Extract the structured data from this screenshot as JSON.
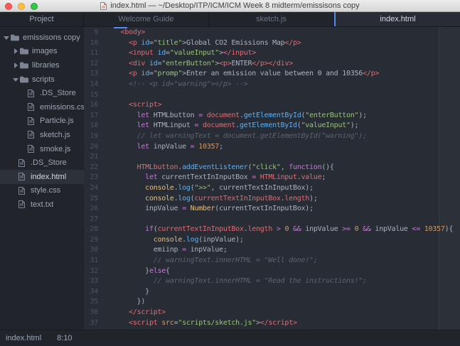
{
  "window": {
    "title": "index.html — ~/Desktop/ITP/ICM/ICM Week 8 midterm/emissisons copy"
  },
  "tabs": [
    {
      "label": "Welcome Guide",
      "active": false
    },
    {
      "label": "sketch.js",
      "active": false
    },
    {
      "label": "index.html",
      "active": true
    }
  ],
  "sidebar": {
    "header": "Project",
    "tree": [
      {
        "label": "emissisons copy",
        "kind": "folder",
        "expanded": true,
        "depth": 0,
        "selected": false
      },
      {
        "label": "images",
        "kind": "folder",
        "expanded": false,
        "depth": 1,
        "selected": false
      },
      {
        "label": "libraries",
        "kind": "folder",
        "expanded": false,
        "depth": 1,
        "selected": false
      },
      {
        "label": "scripts",
        "kind": "folder",
        "expanded": true,
        "depth": 1,
        "selected": false
      },
      {
        "label": ".DS_Store",
        "kind": "file",
        "depth": 2,
        "selected": false
      },
      {
        "label": "emissions.csv",
        "kind": "file",
        "depth": 2,
        "selected": false
      },
      {
        "label": "Particle.js",
        "kind": "file",
        "depth": 2,
        "selected": false
      },
      {
        "label": "sketch.js",
        "kind": "file",
        "depth": 2,
        "selected": false
      },
      {
        "label": "smoke.js",
        "kind": "file",
        "depth": 2,
        "selected": false
      },
      {
        "label": ".DS_Store",
        "kind": "file",
        "depth": 1,
        "selected": false
      },
      {
        "label": "index.html",
        "kind": "file",
        "depth": 1,
        "selected": true
      },
      {
        "label": "style.css",
        "kind": "file",
        "depth": 1,
        "selected": false
      },
      {
        "label": "text.txt",
        "kind": "file",
        "depth": 1,
        "selected": false
      }
    ]
  },
  "editor": {
    "lines": [
      {
        "num": 9,
        "tokens": [
          [
            "p",
            "  "
          ],
          [
            "t",
            "<body>"
          ]
        ]
      },
      {
        "num": 10,
        "tokens": [
          [
            "p",
            "    "
          ],
          [
            "t",
            "<p"
          ],
          [
            "p",
            " "
          ],
          [
            "a",
            "id"
          ],
          [
            "p",
            "="
          ],
          [
            "s",
            "\"title\""
          ],
          [
            "p",
            ">"
          ],
          [
            "p",
            "Global CO2 Emissions Map"
          ],
          [
            "t",
            "</p>"
          ]
        ]
      },
      {
        "num": 11,
        "tokens": [
          [
            "p",
            "    "
          ],
          [
            "t",
            "<input"
          ],
          [
            "p",
            " "
          ],
          [
            "a",
            "id"
          ],
          [
            "p",
            "="
          ],
          [
            "s",
            "\"valueInput\""
          ],
          [
            "p",
            ">"
          ],
          [
            "t",
            "</input>"
          ]
        ]
      },
      {
        "num": 12,
        "tokens": [
          [
            "p",
            "    "
          ],
          [
            "t",
            "<div"
          ],
          [
            "p",
            " "
          ],
          [
            "a",
            "id"
          ],
          [
            "p",
            "="
          ],
          [
            "s",
            "\"enterButton\""
          ],
          [
            "p",
            ">"
          ],
          [
            "t",
            "<p>"
          ],
          [
            "p",
            "ENTER"
          ],
          [
            "t",
            "</p></div>"
          ]
        ]
      },
      {
        "num": 13,
        "tokens": [
          [
            "p",
            "    "
          ],
          [
            "t",
            "<p"
          ],
          [
            "p",
            " "
          ],
          [
            "a",
            "id"
          ],
          [
            "p",
            "="
          ],
          [
            "s",
            "\"promp\""
          ],
          [
            "p",
            ">"
          ],
          [
            "p",
            "Enter an emission value between 0 and 10356"
          ],
          [
            "t",
            "</p>"
          ]
        ]
      },
      {
        "num": 14,
        "tokens": [
          [
            "p",
            "    "
          ],
          [
            "c",
            "<!-- <p id=\"warning\"></p> -->"
          ]
        ]
      },
      {
        "num": 15,
        "tokens": []
      },
      {
        "num": 16,
        "tokens": [
          [
            "p",
            "    "
          ],
          [
            "t",
            "<script>"
          ]
        ]
      },
      {
        "num": 17,
        "tokens": [
          [
            "p",
            "      "
          ],
          [
            "k",
            "let"
          ],
          [
            "p",
            " HTMLbutton "
          ],
          [
            "k",
            "="
          ],
          [
            "p",
            " "
          ],
          [
            "o",
            "document"
          ],
          [
            "p",
            "."
          ],
          [
            "f",
            "getElementById"
          ],
          [
            "p",
            "("
          ],
          [
            "s",
            "\"enterButton\""
          ],
          [
            "p",
            ");"
          ]
        ]
      },
      {
        "num": 18,
        "tokens": [
          [
            "p",
            "      "
          ],
          [
            "k",
            "let"
          ],
          [
            "p",
            " HTMLinput "
          ],
          [
            "k",
            "="
          ],
          [
            "p",
            " "
          ],
          [
            "o",
            "document"
          ],
          [
            "p",
            "."
          ],
          [
            "f",
            "getElementById"
          ],
          [
            "p",
            "("
          ],
          [
            "s",
            "\"valueInput\""
          ],
          [
            "p",
            ");"
          ]
        ]
      },
      {
        "num": 19,
        "tokens": [
          [
            "p",
            "      "
          ],
          [
            "c",
            "// let warningText = document.getElementById(\"warning\");"
          ]
        ]
      },
      {
        "num": 20,
        "tokens": [
          [
            "p",
            "      "
          ],
          [
            "k",
            "let"
          ],
          [
            "p",
            " inpValue "
          ],
          [
            "k",
            "="
          ],
          [
            "p",
            " "
          ],
          [
            "n",
            "10357"
          ],
          [
            "p",
            ";"
          ]
        ]
      },
      {
        "num": 21,
        "tokens": []
      },
      {
        "num": 22,
        "tokens": [
          [
            "p",
            "      "
          ],
          [
            "o",
            "HTMLbutton"
          ],
          [
            "p",
            "."
          ],
          [
            "f",
            "addEventListener"
          ],
          [
            "p",
            "("
          ],
          [
            "s",
            "\"click\""
          ],
          [
            "p",
            ", "
          ],
          [
            "k",
            "function"
          ],
          [
            "p",
            "(){"
          ]
        ]
      },
      {
        "num": 23,
        "tokens": [
          [
            "p",
            "        "
          ],
          [
            "k",
            "let"
          ],
          [
            "p",
            " currentTextInInputBox "
          ],
          [
            "k",
            "="
          ],
          [
            "p",
            " "
          ],
          [
            "o",
            "HTMLinput"
          ],
          [
            "p",
            "."
          ],
          [
            "o",
            "value"
          ],
          [
            "p",
            ";"
          ]
        ]
      },
      {
        "num": 24,
        "tokens": [
          [
            "p",
            "        "
          ],
          [
            "y",
            "console"
          ],
          [
            "p",
            "."
          ],
          [
            "f",
            "log"
          ],
          [
            "p",
            "("
          ],
          [
            "s",
            "\">>\""
          ],
          [
            "p",
            ", currentTextInInputBox);"
          ]
        ]
      },
      {
        "num": 25,
        "tokens": [
          [
            "p",
            "        "
          ],
          [
            "y",
            "console"
          ],
          [
            "p",
            "."
          ],
          [
            "f",
            "log"
          ],
          [
            "p",
            "("
          ],
          [
            "o",
            "currentTextInInputBox"
          ],
          [
            "p",
            "."
          ],
          [
            "o",
            "length"
          ],
          [
            "p",
            ");"
          ]
        ]
      },
      {
        "num": 26,
        "tokens": [
          [
            "p",
            "        inpValue "
          ],
          [
            "k",
            "="
          ],
          [
            "p",
            " "
          ],
          [
            "y",
            "Number"
          ],
          [
            "p",
            "(currentTextInInputBox);"
          ]
        ]
      },
      {
        "num": 27,
        "tokens": []
      },
      {
        "num": 28,
        "tokens": [
          [
            "p",
            "        "
          ],
          [
            "k",
            "if"
          ],
          [
            "p",
            "("
          ],
          [
            "o",
            "currentTextInInputBox"
          ],
          [
            "p",
            "."
          ],
          [
            "o",
            "length"
          ],
          [
            "p",
            " "
          ],
          [
            "k",
            ">"
          ],
          [
            "p",
            " "
          ],
          [
            "n",
            "0"
          ],
          [
            "p",
            " "
          ],
          [
            "k",
            "&&"
          ],
          [
            "p",
            " inpValue "
          ],
          [
            "k",
            ">="
          ],
          [
            "p",
            " "
          ],
          [
            "n",
            "0"
          ],
          [
            "p",
            " "
          ],
          [
            "k",
            "&&"
          ],
          [
            "p",
            " inpValue "
          ],
          [
            "k",
            "<="
          ],
          [
            "p",
            " "
          ],
          [
            "n",
            "10357"
          ],
          [
            "p",
            "){"
          ]
        ]
      },
      {
        "num": 29,
        "tokens": [
          [
            "p",
            "          "
          ],
          [
            "y",
            "console"
          ],
          [
            "p",
            "."
          ],
          [
            "f",
            "log"
          ],
          [
            "p",
            "(inpValue);"
          ]
        ]
      },
      {
        "num": 30,
        "tokens": [
          [
            "p",
            "          emiinp "
          ],
          [
            "k",
            "="
          ],
          [
            "p",
            " inpValue;"
          ]
        ]
      },
      {
        "num": 31,
        "tokens": [
          [
            "p",
            "          "
          ],
          [
            "c",
            "// warningText.innerHTML = \"Well done!\";"
          ]
        ]
      },
      {
        "num": 32,
        "tokens": [
          [
            "p",
            "        }"
          ],
          [
            "k",
            "else"
          ],
          [
            "p",
            "{"
          ]
        ]
      },
      {
        "num": 33,
        "tokens": [
          [
            "p",
            "          "
          ],
          [
            "c",
            "// warningText.innerHTML = \"Read the instructions!\";"
          ]
        ]
      },
      {
        "num": 34,
        "tokens": [
          [
            "p",
            "        }"
          ]
        ]
      },
      {
        "num": 35,
        "tokens": [
          [
            "p",
            "      })"
          ]
        ]
      },
      {
        "num": 36,
        "tokens": [
          [
            "p",
            "    "
          ],
          [
            "t",
            "</script>"
          ]
        ]
      },
      {
        "num": 37,
        "tokens": [
          [
            "p",
            "    "
          ],
          [
            "t",
            "<script"
          ],
          [
            "p",
            " "
          ],
          [
            "ab",
            "src"
          ],
          [
            "p",
            "="
          ],
          [
            "s",
            "\"scripts/sketch.js\""
          ],
          [
            "p",
            ">"
          ],
          [
            "t",
            "</script>"
          ]
        ]
      }
    ]
  },
  "status_bar": {
    "file": "index.html",
    "position": "8:10"
  },
  "colors": {
    "editor_bg": "#282c34",
    "panel_bg": "#21252b",
    "tab_accent_blue": "#568af2",
    "cursor_blue": "#528bff",
    "traffic_close": "#fc5b57",
    "traffic_minimize": "#fdbe41",
    "traffic_zoom": "#34c84a",
    "syntax": {
      "tag": "#e06c75",
      "attribute_id": "#61afef",
      "attribute": "#d19a66",
      "string": "#98c379",
      "comment": "#5c6370",
      "keyword_operator": "#c678dd",
      "number": "#d19a66",
      "object_property": "#e06c75",
      "function_call": "#61afef",
      "support_class": "#e5c07b",
      "plain": "#abb2bf"
    }
  }
}
